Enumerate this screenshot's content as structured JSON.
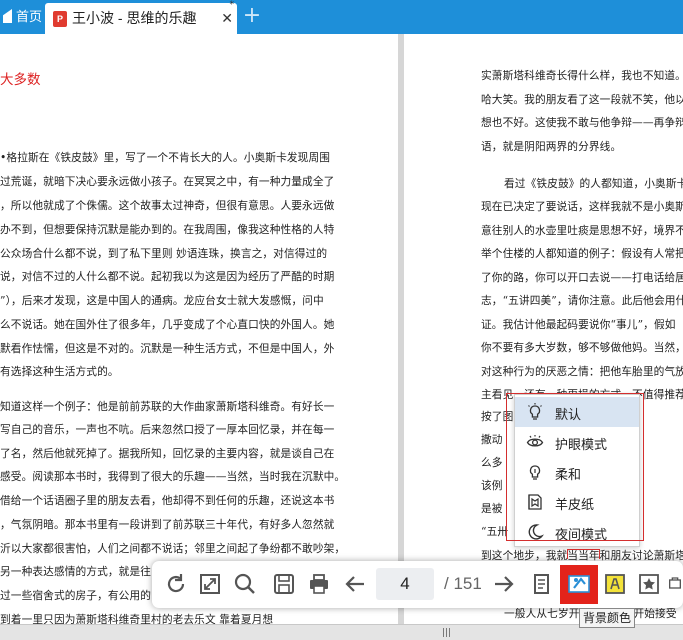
{
  "tabs": {
    "home_label": "首页",
    "doc_badge": "P",
    "doc_title": "王小波 - 思维的乐趣",
    "doc_marker": "*",
    "close_glyph": "✕",
    "new_tab_glyph": "+"
  },
  "left_page": {
    "heading": "大多数",
    "lines": [
      "•格拉斯在《铁皮鼓》里，写了一个不肯长大的人。小奥斯卡发现周围",
      "过荒诞，就暗下决心要永远做小孩子。在冥冥之中，有一种力量成全了",
      "，所以他就成了个侏儒。这个故事太过神奇，但很有意思。人要永远做",
      "办不到，但想要保持沉默是能办到的。在我周围，像我这种性格的人特",
      "公众场合什么都不说，到了私下里则 妙语连珠，换言之，对信得过的",
      "说，对信不过的人什么都不说。起初我以为这是因为经历了严酷的时期",
      "”），后来才发现，这是中国人的通病。龙应台女士就大发感慨，问中",
      "么不说话。她在国外住了很多年，几乎变成了个心直口快的外国人。她",
      "默看作怯懦，但这是不对的。沉默是一种生活方式，不但是中国人，外",
      "有选择这种生活方式的。",
      "知道这样一个例子：他是前前苏联的大作曲家萧斯塔科维奇。有好长一",
      "写自己的音乐，一声也不吭。后来忽然口授了一厚本回忆录，并在每一",
      "了名，然后他就死掉了。据我所知，回忆录的主要内容，就是谈自己在",
      "感受。阅读那本书时，我得到了很大的乐趣——当然，当时我在沉默中。",
      "借给一个话语圈子里的朋友去看，他却得不到任何的乐趣，还说这本书",
      "，气氛阴暗。那本书里有一段讲到了前苏联三十年代，有好多人忽然就",
      "沂以大家都很害怕，人们之间都不说话；邻里之间起了争纷都不敢吵架，",
      "另一种表达感情的方式，就是往",
      "过一些宿舍式的房子，有公用的",
      "到着一里只因为萧斯塔科维奇里村的老去乐文    靠着夏月想"
    ]
  },
  "right_page": {
    "lines": [
      "实萧斯塔科维奇长得什么样，我也不知道。我",
      "哈大笑。我的朋友看了这一段就不笑，他以为",
      "想也不好。这使我不敢与他争辩——再争辩",
      "语，就是阴阳两界的分界线。",
      "看过《铁皮鼓》的人都知道，小奥斯卡",
      "现在已决定了要说话，这样我就不是小奥斯卡",
      "意往别人的水壶里吐痰是思想不好，境界不",
      "举个住楼的人都知道的例子：假设有人常把",
      "了你的路，你可以开口去说——打电话给居委",
      "志，“五讲四美”，请你注意。此后他会用什",
      "证。我估计他最起码要说你“事儿”，假如",
      "你不要有多大岁数，够不够做他妈。当然，你",
      "对这种行为的厌恶之情：把他车胎里的气放",
      "主看见，还有一种更损的方式，不值得推荐",
      "按了图",
      "撒动",
      "么多",
      "该例",
      "是被",
      "“五卅",
      "到这个地步，我就当当年和朋友讨论萧斯塔",
      "一般人从七岁开始看谁，才开始接受"
    ]
  },
  "toolbar": {
    "icons": [
      "rotate-icon",
      "fit-screen-icon",
      "search-icon",
      "save-icon",
      "print-icon",
      "prev-page-icon",
      "next-page-icon",
      "single-page-icon",
      "background-color-icon",
      "annotate-icon",
      "bookmark-icon",
      "more-icon"
    ],
    "page_value": "4",
    "page_total": "/ 151",
    "highlight_color": "#e3231b"
  },
  "background_menu": {
    "items": [
      {
        "label": "默认",
        "icon": "bulb-icon",
        "selected": true
      },
      {
        "label": "护眼模式",
        "icon": "eye-icon",
        "selected": false
      },
      {
        "label": "柔和",
        "icon": "soft-bulb-icon",
        "selected": false
      },
      {
        "label": "羊皮纸",
        "icon": "parchment-icon",
        "selected": false
      },
      {
        "label": "夜间模式",
        "icon": "moon-icon",
        "selected": false
      }
    ]
  },
  "tooltip": "背景颜色",
  "colors": {
    "tab_bar": "#1e8fd9",
    "heading_red": "#d22222",
    "selected_item": "#d8e4f2"
  }
}
